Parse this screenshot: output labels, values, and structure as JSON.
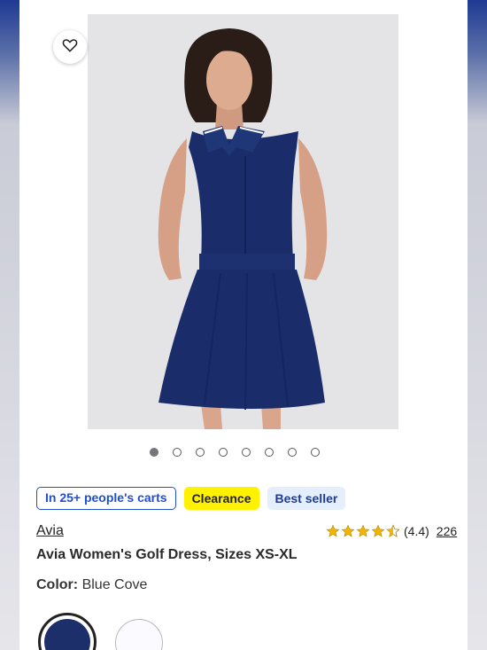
{
  "product": {
    "image_alt": "Woman wearing navy sleeveless golf dress",
    "favorite_icon": "heart-outline-icon",
    "image_dots": {
      "count": 8,
      "active_index": 0
    },
    "badges": [
      {
        "label": "In 25+ people's carts",
        "style": "outline-blue"
      },
      {
        "label": "Clearance",
        "style": "yellow"
      },
      {
        "label": "Best seller",
        "style": "light-blue"
      }
    ],
    "brand": "Avia",
    "rating": {
      "stars": 4.4,
      "text": "(4.4)",
      "count": "226"
    },
    "title": "Avia Women's Golf Dress, Sizes XS-XL",
    "color": {
      "label": "Color:",
      "value": "Blue Cove"
    },
    "swatches": [
      {
        "name": "Blue Cove",
        "hex": "#1c2f6b",
        "selected": true
      },
      {
        "name": "White",
        "hex": "#fbfbff",
        "selected": false
      }
    ]
  },
  "colors": {
    "accent_blue": "#1f4ed0",
    "star": "#f2b400",
    "dress": "#1a2d6a"
  }
}
